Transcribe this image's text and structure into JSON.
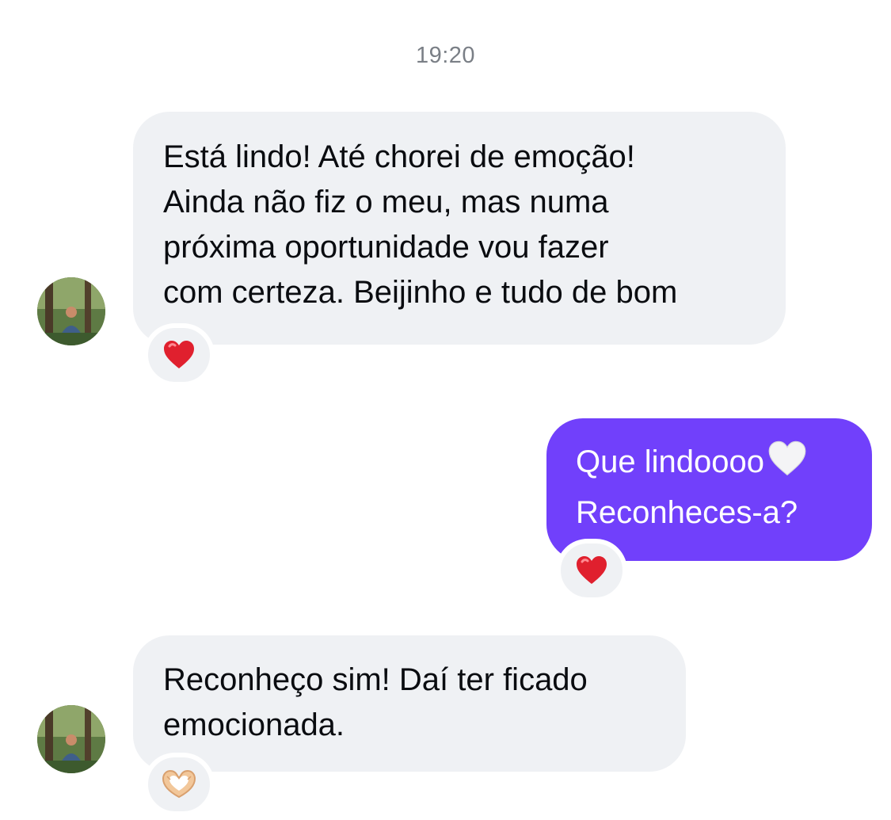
{
  "conversation": {
    "timestamp": "19:20",
    "messages": [
      {
        "direction": "incoming",
        "lines": [
          "Está lindo! Até chorei de emoção!",
          "Ainda não fiz o meu, mas numa",
          "próxima oportunidade vou fazer",
          "com certeza. Beijinho e tudo de bom"
        ],
        "reaction": "red-heart-icon"
      },
      {
        "direction": "outgoing",
        "lines": [
          "Que lindoooo",
          "Reconheces-a?"
        ],
        "inline_emoji": "white-heart-icon",
        "reaction": "red-heart-icon"
      },
      {
        "direction": "incoming",
        "lines": [
          "Reconheço sim! Daí ter ficado",
          "emocionada."
        ],
        "reaction": "heart-hands-icon"
      }
    ]
  },
  "colors": {
    "background": "#ffffff",
    "incoming_bubble": "#eff1f4",
    "outgoing_bubble": "#7140fb",
    "timestamp_text": "#7a7f86",
    "reaction_heart": "#e0202e"
  }
}
